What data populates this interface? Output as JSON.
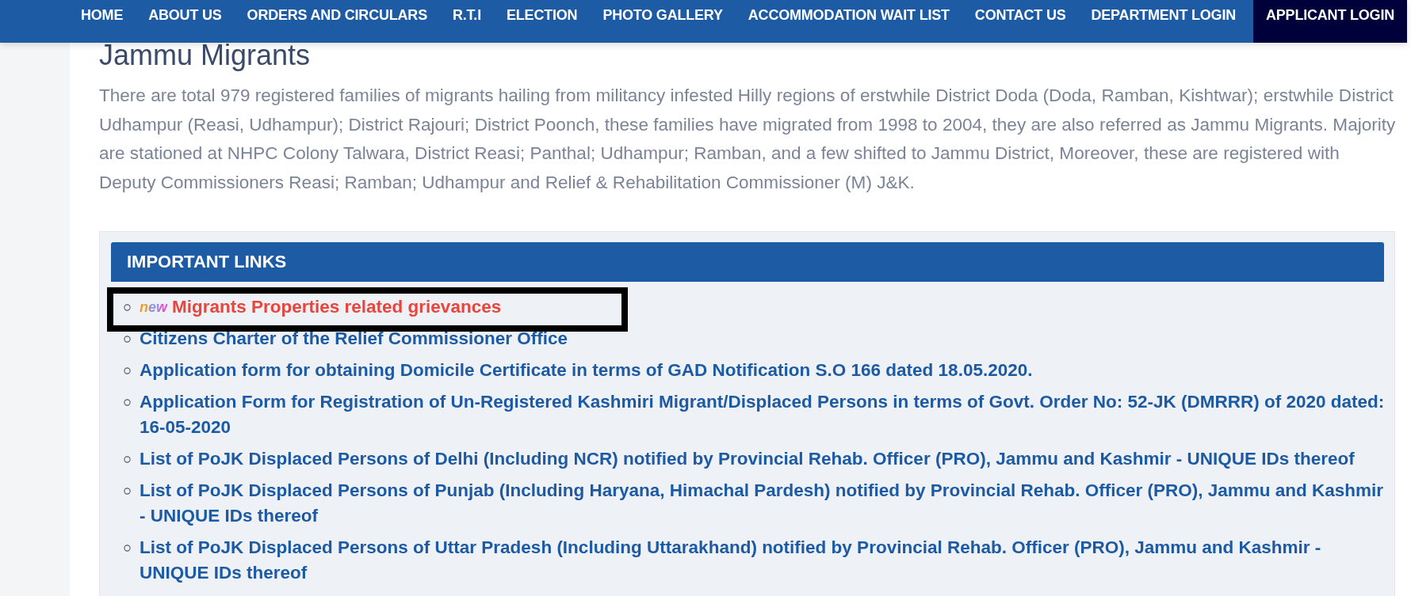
{
  "nav": {
    "items": [
      {
        "label": "HOME",
        "selected": false
      },
      {
        "label": "ABOUT US",
        "selected": false
      },
      {
        "label": "ORDERS AND CIRCULARS",
        "selected": false
      },
      {
        "label": "R.T.I",
        "selected": false
      },
      {
        "label": "ELECTION",
        "selected": false
      },
      {
        "label": "PHOTO GALLERY",
        "selected": false
      },
      {
        "label": "ACCOMMODATION WAIT LIST",
        "selected": false
      },
      {
        "label": "CONTACT US",
        "selected": false
      },
      {
        "label": "DEPARTMENT LOGIN",
        "selected": false
      },
      {
        "label": "APPLICANT LOGIN",
        "selected": true
      }
    ]
  },
  "page": {
    "title": "Jammu Migrants",
    "intro": "There are total 979 registered families of migrants hailing from militancy infested Hilly regions of erstwhile District Doda (Doda, Ramban, Kishtwar); erstwhile District Udhampur (Reasi, Udhampur); District Rajouri; District Poonch, these families have migrated from 1998 to 2004, they are also referred as Jammu Migrants. Majority are stationed at NHPC Colony Talwara, District Reasi; Panthal; Udhampur; Ramban, and a few shifted to Jammu District, Moreover, these are registered with Deputy Commissioners Reasi; Ramban; Udhampur and Relief & Rehabilitation Commissioner (M) J&K."
  },
  "important_links": {
    "title": "IMPORTANT LINKS",
    "items": [
      {
        "kind": "alert",
        "badge": "new",
        "label": "Migrants Properties related grievances",
        "highlighted": true
      },
      {
        "kind": "normal",
        "label": "Citizens Charter of the Relief Commissioner Office",
        "highlighted": false
      },
      {
        "kind": "normal",
        "label": "Application form for obtaining Domicile Certificate in terms of GAD Notification S.O 166 dated 18.05.2020.",
        "highlighted": false
      },
      {
        "kind": "normal",
        "label": "Application Form for Registration of Un-Registered Kashmiri Migrant/Displaced Persons in terms of Govt. Order No: 52-JK (DMRRR) of 2020 dated: 16-05-2020",
        "highlighted": false
      },
      {
        "kind": "normal",
        "label": "List of PoJK Displaced Persons of Delhi (Including NCR) notified by Provincial Rehab. Officer (PRO), Jammu and Kashmir - UNIQUE IDs thereof",
        "highlighted": false
      },
      {
        "kind": "normal",
        "label": "List of PoJK Displaced Persons of Punjab (Including Haryana, Himachal Pardesh) notified by Provincial Rehab. Officer (PRO), Jammu and Kashmir - UNIQUE IDs thereof",
        "highlighted": false
      },
      {
        "kind": "normal",
        "label": "List of PoJK Displaced Persons of Uttar Pradesh (Including Uttarakhand) notified by Provincial Rehab. Officer (PRO), Jammu and Kashmir - UNIQUE IDs thereof",
        "highlighted": false
      }
    ]
  }
}
